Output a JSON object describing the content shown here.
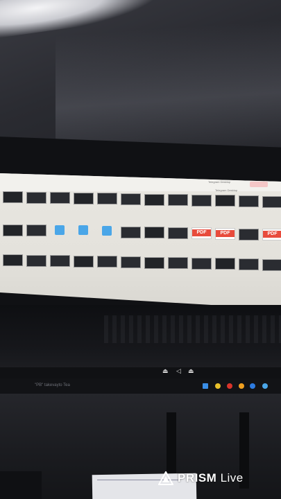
{
  "screen": {
    "path_labels": [
      "Telegram Desktop",
      "Telegram Desktop"
    ],
    "rows": [
      {
        "tiles": [
          {
            "kind": "video",
            "caption": ""
          },
          {
            "kind": "video",
            "caption": ""
          },
          {
            "kind": "video",
            "caption": ""
          },
          {
            "kind": "video",
            "caption": ""
          },
          {
            "kind": "video",
            "caption": ""
          },
          {
            "kind": "video",
            "caption": ""
          },
          {
            "kind": "video",
            "caption": ""
          },
          {
            "kind": "video",
            "caption": ""
          },
          {
            "kind": "video",
            "caption": ""
          },
          {
            "kind": "video",
            "caption": ""
          },
          {
            "kind": "video",
            "caption": ""
          },
          {
            "kind": "video",
            "caption": ""
          }
        ]
      },
      {
        "tiles": [
          {
            "kind": "video",
            "caption": ""
          },
          {
            "kind": "video",
            "caption": ""
          },
          {
            "kind": "telegram",
            "caption": ""
          },
          {
            "kind": "telegram",
            "caption": ""
          },
          {
            "kind": "telegram",
            "caption": ""
          },
          {
            "kind": "video",
            "caption": ""
          },
          {
            "kind": "video",
            "caption": ""
          },
          {
            "kind": "video",
            "caption": ""
          },
          {
            "kind": "pdf",
            "caption": ""
          },
          {
            "kind": "pdf",
            "caption": ""
          },
          {
            "kind": "video",
            "caption": ""
          },
          {
            "kind": "pdf",
            "caption": ""
          }
        ]
      },
      {
        "tiles": [
          {
            "kind": "video",
            "caption": ""
          },
          {
            "kind": "video",
            "caption": ""
          },
          {
            "kind": "video",
            "caption": ""
          },
          {
            "kind": "video",
            "caption": ""
          },
          {
            "kind": "video",
            "caption": ""
          },
          {
            "kind": "video",
            "caption": ""
          },
          {
            "kind": "video",
            "caption": ""
          },
          {
            "kind": "video",
            "caption": ""
          },
          {
            "kind": "video",
            "caption": ""
          },
          {
            "kind": "video",
            "caption": ""
          },
          {
            "kind": "video",
            "caption": ""
          },
          {
            "kind": "video",
            "caption": ""
          }
        ]
      }
    ]
  },
  "taskbar": {
    "text": "\"PB\" takevayto Tea"
  },
  "watermark": {
    "brand": "PRISM",
    "suffix": "Live"
  },
  "colors": {
    "pdf_red": "#e84b3c",
    "telegram_blue": "#4aa6e8",
    "icon_chrome": "#e8c02a"
  }
}
